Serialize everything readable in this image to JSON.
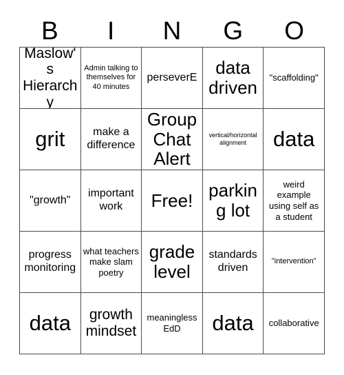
{
  "card": {
    "header_letters": [
      "B",
      "I",
      "N",
      "G",
      "O"
    ],
    "columns": 5,
    "rows": 5,
    "free_space_index": 12,
    "colors": {
      "background": "#ffffff",
      "text": "#000000",
      "grid_line": "#4a4a4a"
    },
    "cells": [
      {
        "text": "Maslow's Hierarchy",
        "size": "lg"
      },
      {
        "text": "Admin talking to themselves for 40 minutes",
        "size": "xs"
      },
      {
        "text": "perseverE",
        "size": "md"
      },
      {
        "text": "data driven",
        "size": "xl"
      },
      {
        "text": "\"scaffolding\"",
        "size": "sm"
      },
      {
        "text": "grit",
        "size": "xxl"
      },
      {
        "text": "make a difference",
        "size": "md"
      },
      {
        "text": "Group Chat Alert",
        "size": "xl"
      },
      {
        "text": "vertical/horizontal alignment",
        "size": "xxs"
      },
      {
        "text": "data",
        "size": "xxl"
      },
      {
        "text": "\"growth\"",
        "size": "md"
      },
      {
        "text": "important work",
        "size": "md"
      },
      {
        "text": "Free!",
        "size": "xl"
      },
      {
        "text": "parking lot",
        "size": "xl"
      },
      {
        "text": "weird example using self as a student",
        "size": "sm"
      },
      {
        "text": "progress monitoring",
        "size": "md"
      },
      {
        "text": "what teachers make slam poetry",
        "size": "sm"
      },
      {
        "text": "grade level",
        "size": "xl"
      },
      {
        "text": "standards driven",
        "size": "md"
      },
      {
        "text": "\"intervention\"",
        "size": "xs"
      },
      {
        "text": "data",
        "size": "xxl"
      },
      {
        "text": "growth mindset",
        "size": "lg"
      },
      {
        "text": "meaningless EdD",
        "size": "sm"
      },
      {
        "text": "data",
        "size": "xxl"
      },
      {
        "text": "collaborative",
        "size": "sm"
      }
    ]
  }
}
